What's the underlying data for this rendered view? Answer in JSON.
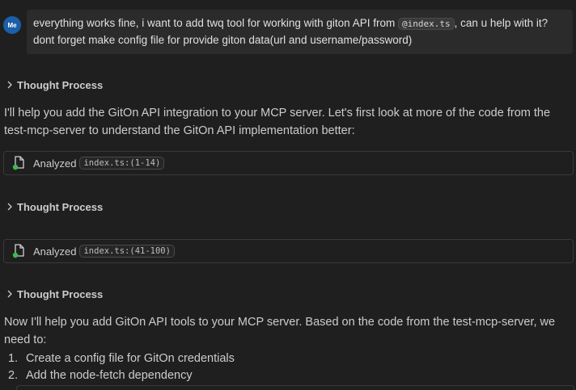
{
  "user_message": {
    "avatar_label": "Me",
    "text_before": "everything works fine, i want to add twq tool for working with giton API from ",
    "mention": "@index.ts",
    "text_after": ", can u help with it? dont forget make config file for provide giton data(url and username/password)"
  },
  "thoughts": [
    {
      "label": "Thought Process"
    },
    {
      "label": "Thought Process"
    },
    {
      "label": "Thought Process"
    }
  ],
  "paragraphs": [
    "I'll help you add the GitOn API integration to your MCP server. Let's first look at more of the code from the test-mcp-server to understand the GitOn API implementation better:",
    "Now I'll help you add GitOn API tools to your MCP server. Based on the code from the test-mcp-server, we need to:"
  ],
  "tool_calls": [
    {
      "status": "Analyzed",
      "ref": "index.ts:(1-14)",
      "icon": "file-check-icon"
    },
    {
      "status": "Analyzed",
      "ref": "index.ts:(41-100)",
      "icon": "file-check-icon"
    }
  ],
  "steps": [
    {
      "num": "1.",
      "text": "Create a config file for GitOn credentials"
    },
    {
      "num": "2.",
      "text": "Add the node-fetch dependency"
    }
  ],
  "colors": {
    "background": "#1f1f1f",
    "bubble": "#2b2b2b",
    "avatar": "#1a5fa8",
    "success_dot": "#3fb950"
  }
}
